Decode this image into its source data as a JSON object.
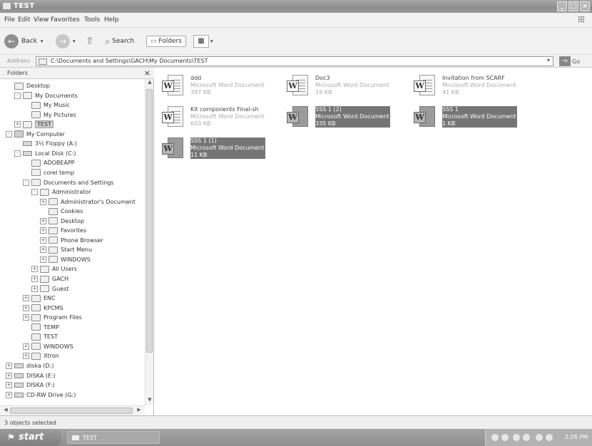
{
  "window": {
    "title": "TEST"
  },
  "menu": [
    "File",
    "Edit",
    "View",
    "Favorites",
    "Tools",
    "Help"
  ],
  "toolbar": {
    "back": "Back",
    "search": "Search",
    "folders": "Folders"
  },
  "address": {
    "label": "Address",
    "value": "C:\\Documents and Settings\\GACH\\My Documents\\TEST",
    "go": "Go"
  },
  "folders_pane": {
    "title": "Folders"
  },
  "tree": [
    {
      "label": "Desktop"
    },
    {
      "label": "My Documents"
    },
    {
      "label": "My Music"
    },
    {
      "label": "My Pictures"
    },
    {
      "label": "TEST",
      "selected": true
    },
    {
      "label": "My Computer"
    },
    {
      "label": "3½ Floppy (A:)"
    },
    {
      "label": "Local Disk (C:)"
    },
    {
      "label": "ADOBEAPP"
    },
    {
      "label": "corel temp"
    },
    {
      "label": "Documents and Settings"
    },
    {
      "label": "Administrator"
    },
    {
      "label": "Administrator's Document"
    },
    {
      "label": "Cookies"
    },
    {
      "label": "Desktop"
    },
    {
      "label": "Favorites"
    },
    {
      "label": "Phone Browser"
    },
    {
      "label": "Start Menu"
    },
    {
      "label": "WINDOWS"
    },
    {
      "label": "All Users"
    },
    {
      "label": "GACH"
    },
    {
      "label": "Guest"
    },
    {
      "label": "ENC"
    },
    {
      "label": "KPCMS"
    },
    {
      "label": "Program Files"
    },
    {
      "label": "TEMP"
    },
    {
      "label": "TEST"
    },
    {
      "label": "WINDOWS"
    },
    {
      "label": "Xtron"
    },
    {
      "label": "diska (D:)"
    },
    {
      "label": "DISKA (E:)"
    },
    {
      "label": "DISKA (F:)"
    },
    {
      "label": "CD-RW Drive (G:)"
    }
  ],
  "files": [
    {
      "name": "ddd",
      "type": "Microsoft Word Document",
      "size": "397 KB",
      "selected": false
    },
    {
      "name": "Doc3",
      "type": "Microsoft Word Document",
      "size": "19 KB",
      "selected": false
    },
    {
      "name": "Invitation from SCARF",
      "type": "Microsoft Word Document",
      "size": "41 KB",
      "selected": false
    },
    {
      "name": "Kit components Final-sh",
      "type": "Microsoft Word Document",
      "size": "603 KB",
      "selected": false
    },
    {
      "name": "SSS 1 (2)",
      "type": "Microsoft Word Document",
      "size": "335 KB",
      "selected": true
    },
    {
      "name": "SSS 1",
      "type": "Microsoft Word Document",
      "size": "1 KB",
      "selected": true
    },
    {
      "name": "SSS 1 (1)",
      "type": "Microsoft Word Document",
      "size": "11 KB",
      "selected": true
    }
  ],
  "status": {
    "text": "3 objects selected"
  },
  "taskbar": {
    "start": "start",
    "task": "TEST",
    "clock": "2:26 PM"
  }
}
